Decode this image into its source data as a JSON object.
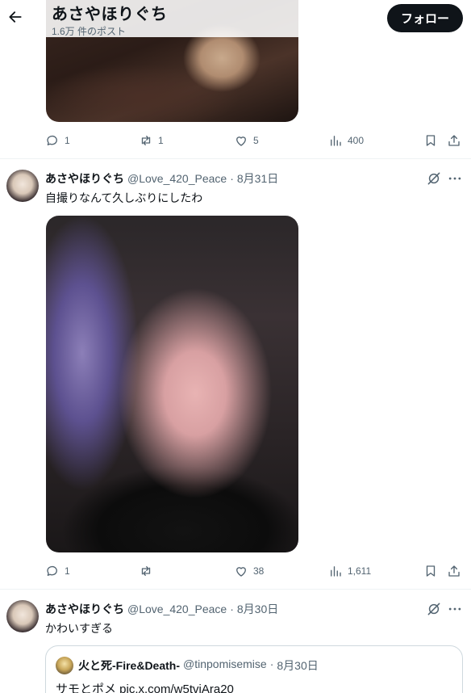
{
  "header": {
    "title": "あさやほりぐち",
    "subtitle": "1.6万 件のポスト",
    "follow_label": "フォロー"
  },
  "tweets": [
    {
      "actions": {
        "replies": "1",
        "reposts": "1",
        "likes": "5",
        "views": "400"
      }
    },
    {
      "name": "あさやほりぐち",
      "handle": "@Love_420_Peace",
      "dot": "·",
      "date": "8月31日",
      "text": "自撮りなんて久しぶりにしたわ",
      "actions": {
        "replies": "1",
        "reposts": "",
        "likes": "38",
        "views": "1,611"
      }
    },
    {
      "name": "あさやほりぐち",
      "handle": "@Love_420_Peace",
      "dot": "·",
      "date": "8月30日",
      "text": "かわいすぎる",
      "quote": {
        "name": "火と死-Fire&Death-",
        "handle": "@tinpomisemise",
        "dot": "·",
        "date": "8月30日",
        "text": "サモとポメ pic.x.com/w5tvjAra20"
      }
    }
  ],
  "icons": [
    "back-arrow-icon",
    "reply-icon",
    "repost-icon",
    "like-icon",
    "views-icon",
    "bookmark-icon",
    "share-icon",
    "grok-icon",
    "more-icon"
  ]
}
